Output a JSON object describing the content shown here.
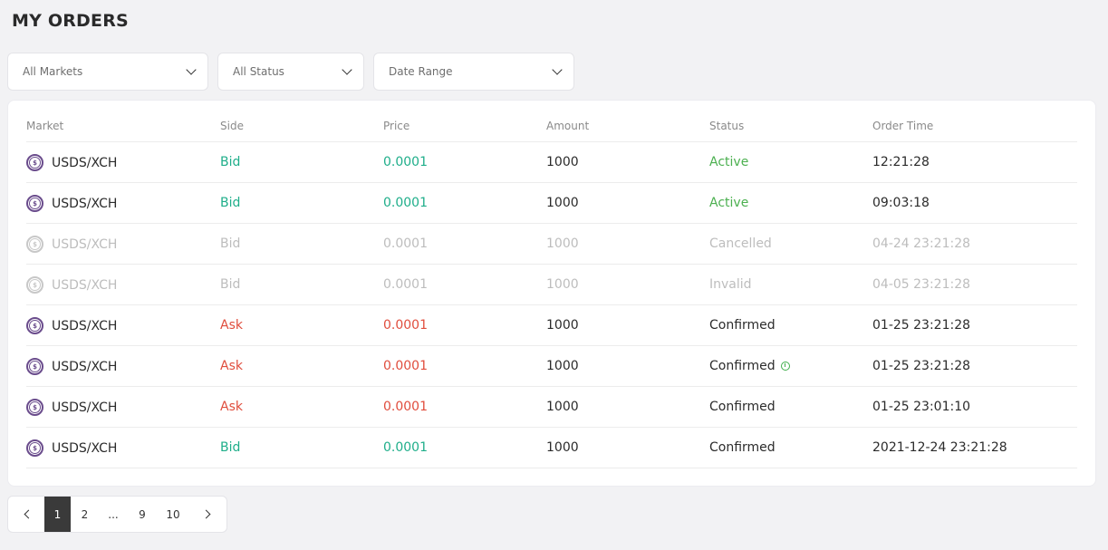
{
  "page": {
    "title": "MY ORDERS"
  },
  "filters": {
    "market": "All Markets",
    "status": "All Status",
    "date": "Date Range"
  },
  "table": {
    "columns": [
      "Market",
      "Side",
      "Price",
      "Amount",
      "Status",
      "Order Time"
    ],
    "rows": [
      {
        "market": "USDS/XCH",
        "side": "Bid",
        "price": "0.0001",
        "amount": "1000",
        "status": "Active",
        "time": "12:21:28"
      },
      {
        "market": "USDS/XCH",
        "side": "Bid",
        "price": "0.0001",
        "amount": "1000",
        "status": "Active",
        "time": "09:03:18"
      },
      {
        "market": "USDS/XCH",
        "side": "Bid",
        "price": "0.0001",
        "amount": "1000",
        "status": "Cancelled",
        "time": "04-24  23:21:28"
      },
      {
        "market": "USDS/XCH",
        "side": "Bid",
        "price": "0.0001",
        "amount": "1000",
        "status": "Invalid",
        "time": "04-05  23:21:28"
      },
      {
        "market": "USDS/XCH",
        "side": "Ask",
        "price": "0.0001",
        "amount": "1000",
        "status": "Confirmed",
        "time": "01-25  23:21:28"
      },
      {
        "market": "USDS/XCH",
        "side": "Ask",
        "price": "0.0001",
        "amount": "1000",
        "status": "Confirmed",
        "time": "01-25  23:21:28"
      },
      {
        "market": "USDS/XCH",
        "side": "Ask",
        "price": "0.0001",
        "amount": "1000",
        "status": "Confirmed",
        "time": "01-25  23:01:10"
      },
      {
        "market": "USDS/XCH",
        "side": "Bid",
        "price": "0.0001",
        "amount": "1000",
        "status": "Confirmed",
        "time": "2021-12-24  23:21:28"
      }
    ]
  },
  "coin_icon_glyph": "$",
  "colors": {
    "bid": "#1fae8a",
    "ask": "#e04d3d",
    "active": "#4cb050",
    "coin": "#6a4c8c"
  },
  "pagination": {
    "pages": [
      "1",
      "2",
      "...",
      "9",
      "10"
    ],
    "current": "1"
  }
}
